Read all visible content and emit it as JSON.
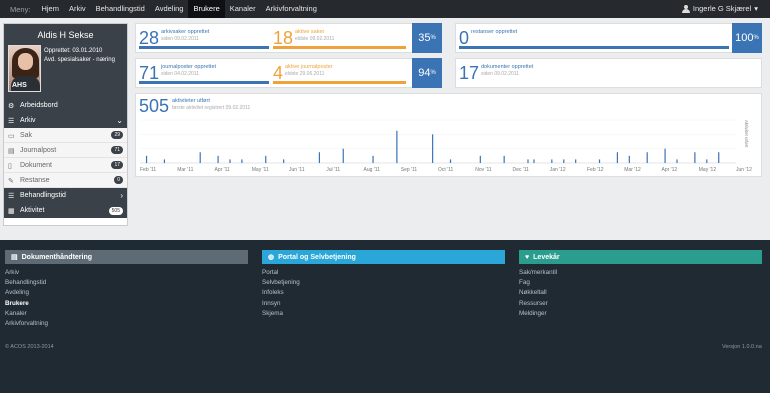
{
  "topbar": {
    "menu_label": "Meny:",
    "items": [
      "Hjem",
      "Arkiv",
      "Behandlingstid",
      "Avdeling",
      "Brukere",
      "Kanaler",
      "Arkivforvaltning"
    ],
    "active_index": 4,
    "user": "Ingerle G Skjærel"
  },
  "profile": {
    "name": "Aldis H Sekse",
    "created": "Opprettet: 03.01.2010",
    "department": "Avd. spesialsaker - næring",
    "avatar_text": "AHS"
  },
  "sidebar": {
    "dashboard": "Arbeidsbord",
    "archive": "Arkiv",
    "archive_items": [
      {
        "label": "Sak",
        "count": "29"
      },
      {
        "label": "Journalpost",
        "count": "71"
      },
      {
        "label": "Dokument",
        "count": "17"
      },
      {
        "label": "Restanse",
        "count": "0"
      }
    ],
    "processing": "Behandlingstid",
    "activity": {
      "label": "Aktivitet",
      "count": "505"
    }
  },
  "stats": {
    "cases_created": {
      "num": "28",
      "label": "arkivsaker opprettet",
      "sub": "siden 09.02.2011"
    },
    "cases_active": {
      "num": "18",
      "label": "aktive saker",
      "sub": "eldste 09.02.2011"
    },
    "cases_pct": "35",
    "backlog": {
      "num": "0",
      "label": "restanser opprettet"
    },
    "backlog_pct": "100",
    "posts_created": {
      "num": "71",
      "label": "journalposter opprettet",
      "sub": "siden 04.02.2011"
    },
    "posts_active": {
      "num": "4",
      "label": "aktive journalposter",
      "sub": "eldste 29.06.2011"
    },
    "posts_pct": "94",
    "documents": {
      "num": "17",
      "label": "dokumenter opprettet",
      "sub": "siden 09.02.2011"
    },
    "activities": {
      "num": "505",
      "label": "aktiviteter utført",
      "sub": "første aktivitet registrert 09.02.2011"
    }
  },
  "colors": {
    "blue": "#3a74b5",
    "orange": "#f0a23a",
    "teal": "#2a9d8f",
    "cyan": "#2aa6d8"
  },
  "chart_data": {
    "type": "bar",
    "title": "",
    "xlabel": "",
    "ylabel": "Aktivitet utført",
    "tick_labels": [
      "Feb '11",
      "Mar '11",
      "Apr '11",
      "May '11",
      "Jun '11",
      "Jul '11",
      "Aug '11",
      "Sep '11",
      "Oct '11",
      "Nov '11",
      "Dec '11",
      "Jan '12",
      "Feb '12",
      "Mar '12",
      "Apr '12",
      "May '12",
      "Jun '12"
    ],
    "x": [
      0.01,
      0.04,
      0.1,
      0.13,
      0.15,
      0.17,
      0.21,
      0.24,
      0.3,
      0.34,
      0.39,
      0.43,
      0.49,
      0.52,
      0.57,
      0.61,
      0.65,
      0.66,
      0.69,
      0.71,
      0.73,
      0.77,
      0.8,
      0.82,
      0.85,
      0.88,
      0.9,
      0.93,
      0.95,
      0.97
    ],
    "values": [
      2,
      1,
      3,
      2,
      1,
      1,
      2,
      1,
      3,
      4,
      2,
      9,
      8,
      1,
      2,
      2,
      1,
      1,
      1,
      1,
      1,
      1,
      3,
      2,
      3,
      4,
      1,
      3,
      1,
      3
    ],
    "ylim": [
      0,
      12
    ]
  },
  "footer": {
    "col1": {
      "title": "Dokumenthåndtering",
      "links": [
        "Arkiv",
        "Behandlingstid",
        "Avdeling",
        "Brukere",
        "Kanaler",
        "Arkivforvaltning"
      ],
      "bold_index": 3
    },
    "col2": {
      "title": "Portal og Selvbetjening",
      "links": [
        "Portal",
        "Selvbetjening",
        "Infoleks",
        "Innsyn",
        "Skjema"
      ]
    },
    "col3": {
      "title": "Levekår",
      "links": [
        "Sak/merkantil",
        "Fag",
        "Nøkkeltall",
        "Ressurser",
        "Meldinger"
      ]
    },
    "copyright": "© ACOS 2013-2014",
    "version": "Versjon 1.0.0.na"
  }
}
